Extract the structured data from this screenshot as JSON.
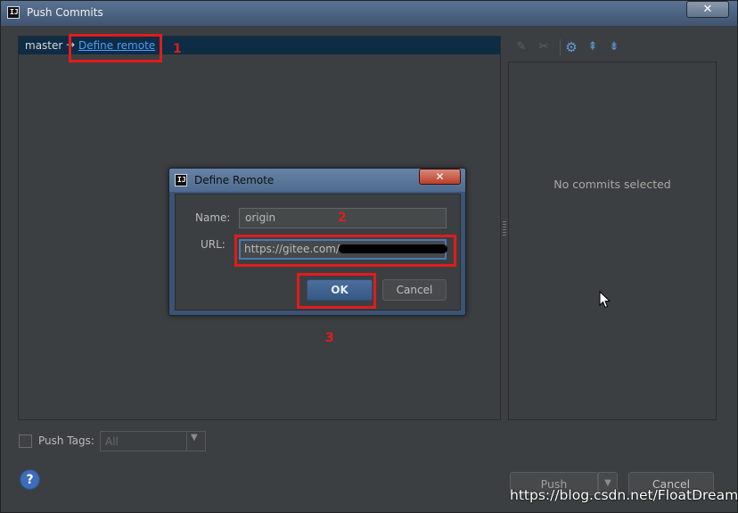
{
  "window": {
    "title": "Push Commits",
    "close_glyph": "✕",
    "icon_text": "IJ"
  },
  "branch_row": {
    "branch": "master",
    "arrow": "→",
    "link": "Define remote"
  },
  "toolbar": {
    "icons": [
      "pin-icon",
      "edit-icon",
      "gear-icon",
      "expand-all-icon",
      "collapse-all-icon"
    ]
  },
  "commits_panel": {
    "empty_text": "No commits selected"
  },
  "bottom": {
    "push_tags_label": "Push Tags:",
    "push_tags_checked": false,
    "tags_select_value": "All",
    "help_glyph": "?",
    "push_label": "Push",
    "cancel_label": "Cancel"
  },
  "dialog": {
    "title": "Define Remote",
    "close_glyph": "✕",
    "name_label": "Name:",
    "name_value": "origin",
    "url_label": "URL:",
    "url_value": "https://gitee.com/",
    "ok_label": "OK",
    "cancel_label": "Cancel"
  },
  "annotations": {
    "one": "1",
    "two": "2",
    "three": "3",
    "color": "#e21b1b"
  },
  "watermark": "https://blog.csdn.net/FloatDreamed"
}
